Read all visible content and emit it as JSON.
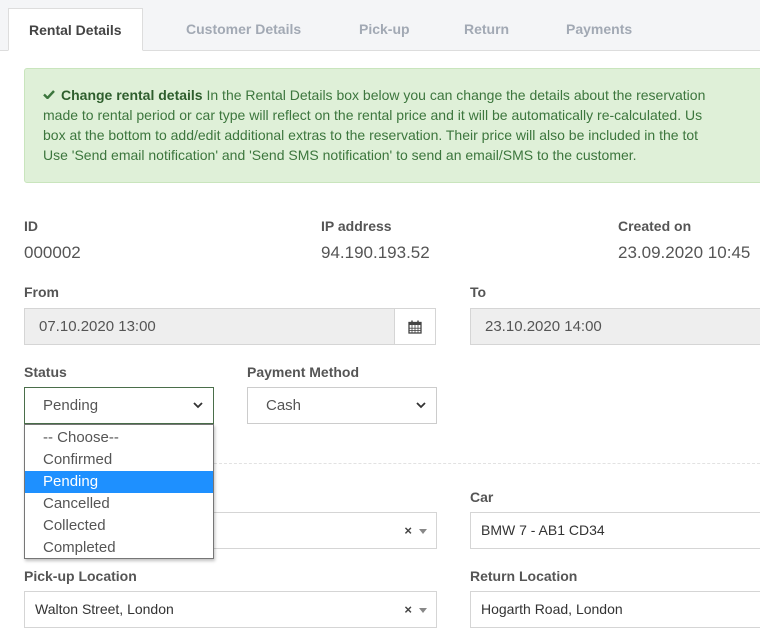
{
  "tabs": [
    {
      "label": "Rental Details",
      "active": true
    },
    {
      "label": "Customer Details",
      "active": false
    },
    {
      "label": "Pick-up",
      "active": false
    },
    {
      "label": "Return",
      "active": false
    },
    {
      "label": "Payments",
      "active": false
    }
  ],
  "alert": {
    "title": "Change rental details",
    "lines": [
      " In the Rental Details box below you can change the details about the reservation",
      "made to rental period or car type will reflect on the rental price and it will be automatically re-calculated. Us",
      "box at the bottom to add/edit additional extras to the reservation. Their price will also be included in the tot",
      "Use 'Send email notification' and 'Send SMS notification' to send an email/SMS to the customer."
    ],
    "color": "#dff0d8"
  },
  "info": {
    "id_label": "ID",
    "id_value": "000002",
    "ip_label": "IP address",
    "ip_value": "94.190.193.52",
    "created_label": "Created on",
    "created_value": "23.09.2020 10:45"
  },
  "dates": {
    "from_label": "From",
    "from_value": "07.10.2020 13:00",
    "to_label": "To",
    "to_value": "23.10.2020 14:00",
    "calendar_icon": "calendar-icon"
  },
  "status": {
    "label": "Status",
    "selected": "Pending",
    "options": [
      "-- Choose--",
      "Confirmed",
      "Pending",
      "Cancelled",
      "Collected",
      "Completed"
    ],
    "highlight_color": "#1e90ff"
  },
  "payment": {
    "label": "Payment Method",
    "selected": "Cash"
  },
  "car": {
    "label": "Car",
    "value": "BMW 7 - AB1 CD34",
    "clear": "×"
  },
  "car_type_clear": "×",
  "pickup": {
    "label": "Pick-up Location",
    "value": "Walton Street, London",
    "clear": "×"
  },
  "return_loc": {
    "label": "Return Location",
    "value": "Hogarth Road, London"
  }
}
